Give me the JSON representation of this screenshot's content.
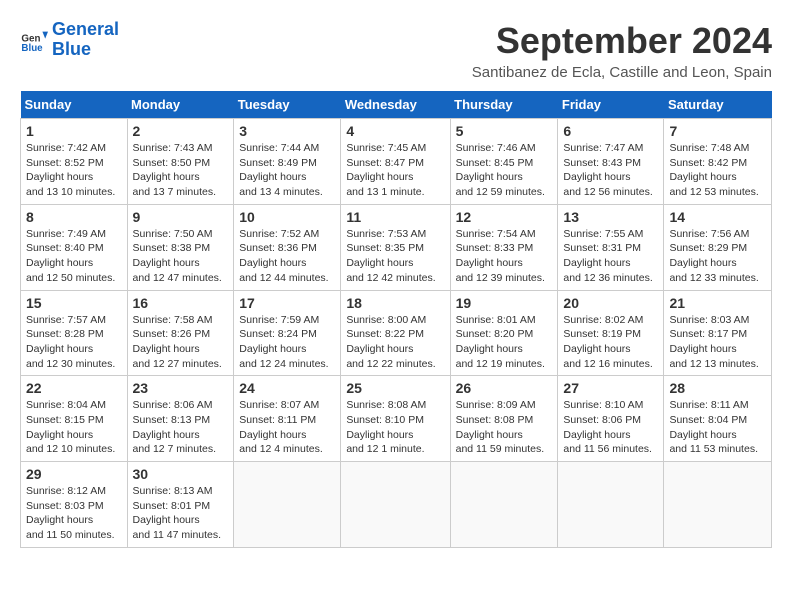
{
  "header": {
    "logo_line1": "General",
    "logo_line2": "Blue",
    "month": "September 2024",
    "location": "Santibanez de Ecla, Castille and Leon, Spain"
  },
  "weekdays": [
    "Sunday",
    "Monday",
    "Tuesday",
    "Wednesday",
    "Thursday",
    "Friday",
    "Saturday"
  ],
  "weeks": [
    [
      {
        "day": "1",
        "rise": "7:42 AM",
        "set": "8:52 PM",
        "daylight": "13 hours and 10 minutes."
      },
      {
        "day": "2",
        "rise": "7:43 AM",
        "set": "8:50 PM",
        "daylight": "13 hours and 7 minutes."
      },
      {
        "day": "3",
        "rise": "7:44 AM",
        "set": "8:49 PM",
        "daylight": "13 hours and 4 minutes."
      },
      {
        "day": "4",
        "rise": "7:45 AM",
        "set": "8:47 PM",
        "daylight": "13 hours and 1 minute."
      },
      {
        "day": "5",
        "rise": "7:46 AM",
        "set": "8:45 PM",
        "daylight": "12 hours and 59 minutes."
      },
      {
        "day": "6",
        "rise": "7:47 AM",
        "set": "8:43 PM",
        "daylight": "12 hours and 56 minutes."
      },
      {
        "day": "7",
        "rise": "7:48 AM",
        "set": "8:42 PM",
        "daylight": "12 hours and 53 minutes."
      }
    ],
    [
      {
        "day": "8",
        "rise": "7:49 AM",
        "set": "8:40 PM",
        "daylight": "12 hours and 50 minutes."
      },
      {
        "day": "9",
        "rise": "7:50 AM",
        "set": "8:38 PM",
        "daylight": "12 hours and 47 minutes."
      },
      {
        "day": "10",
        "rise": "7:52 AM",
        "set": "8:36 PM",
        "daylight": "12 hours and 44 minutes."
      },
      {
        "day": "11",
        "rise": "7:53 AM",
        "set": "8:35 PM",
        "daylight": "12 hours and 42 minutes."
      },
      {
        "day": "12",
        "rise": "7:54 AM",
        "set": "8:33 PM",
        "daylight": "12 hours and 39 minutes."
      },
      {
        "day": "13",
        "rise": "7:55 AM",
        "set": "8:31 PM",
        "daylight": "12 hours and 36 minutes."
      },
      {
        "day": "14",
        "rise": "7:56 AM",
        "set": "8:29 PM",
        "daylight": "12 hours and 33 minutes."
      }
    ],
    [
      {
        "day": "15",
        "rise": "7:57 AM",
        "set": "8:28 PM",
        "daylight": "12 hours and 30 minutes."
      },
      {
        "day": "16",
        "rise": "7:58 AM",
        "set": "8:26 PM",
        "daylight": "12 hours and 27 minutes."
      },
      {
        "day": "17",
        "rise": "7:59 AM",
        "set": "8:24 PM",
        "daylight": "12 hours and 24 minutes."
      },
      {
        "day": "18",
        "rise": "8:00 AM",
        "set": "8:22 PM",
        "daylight": "12 hours and 22 minutes."
      },
      {
        "day": "19",
        "rise": "8:01 AM",
        "set": "8:20 PM",
        "daylight": "12 hours and 19 minutes."
      },
      {
        "day": "20",
        "rise": "8:02 AM",
        "set": "8:19 PM",
        "daylight": "12 hours and 16 minutes."
      },
      {
        "day": "21",
        "rise": "8:03 AM",
        "set": "8:17 PM",
        "daylight": "12 hours and 13 minutes."
      }
    ],
    [
      {
        "day": "22",
        "rise": "8:04 AM",
        "set": "8:15 PM",
        "daylight": "12 hours and 10 minutes."
      },
      {
        "day": "23",
        "rise": "8:06 AM",
        "set": "8:13 PM",
        "daylight": "12 hours and 7 minutes."
      },
      {
        "day": "24",
        "rise": "8:07 AM",
        "set": "8:11 PM",
        "daylight": "12 hours and 4 minutes."
      },
      {
        "day": "25",
        "rise": "8:08 AM",
        "set": "8:10 PM",
        "daylight": "12 hours and 1 minute."
      },
      {
        "day": "26",
        "rise": "8:09 AM",
        "set": "8:08 PM",
        "daylight": "11 hours and 59 minutes."
      },
      {
        "day": "27",
        "rise": "8:10 AM",
        "set": "8:06 PM",
        "daylight": "11 hours and 56 minutes."
      },
      {
        "day": "28",
        "rise": "8:11 AM",
        "set": "8:04 PM",
        "daylight": "11 hours and 53 minutes."
      }
    ],
    [
      {
        "day": "29",
        "rise": "8:12 AM",
        "set": "8:03 PM",
        "daylight": "11 hours and 50 minutes."
      },
      {
        "day": "30",
        "rise": "8:13 AM",
        "set": "8:01 PM",
        "daylight": "11 hours and 47 minutes."
      },
      null,
      null,
      null,
      null,
      null
    ]
  ]
}
